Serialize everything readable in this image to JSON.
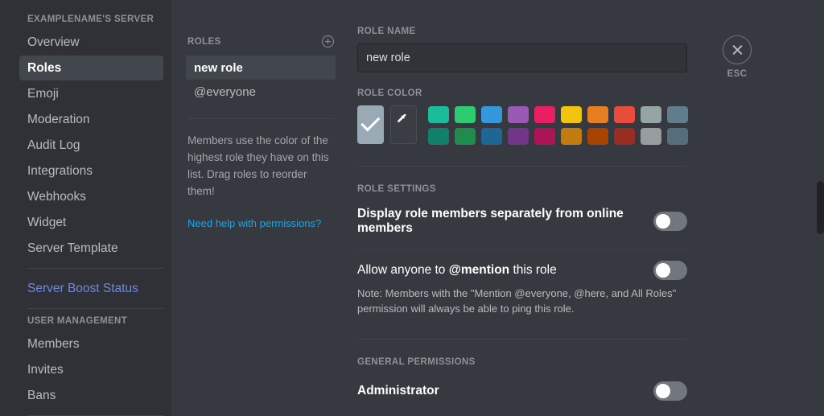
{
  "sidebar": {
    "server_header": "EXAMPLENAME'S SERVER",
    "items": [
      {
        "label": "Overview"
      },
      {
        "label": "Roles"
      },
      {
        "label": "Emoji"
      },
      {
        "label": "Moderation"
      },
      {
        "label": "Audit Log"
      },
      {
        "label": "Integrations"
      },
      {
        "label": "Webhooks"
      },
      {
        "label": "Widget"
      },
      {
        "label": "Server Template"
      }
    ],
    "boost_link": "Server Boost Status",
    "user_management_header": "USER MANAGEMENT",
    "user_items": [
      {
        "label": "Members"
      },
      {
        "label": "Invites"
      },
      {
        "label": "Bans"
      }
    ],
    "active_item": "Roles",
    "link_color": "#7289da"
  },
  "roles_panel": {
    "header": "ROLES",
    "add_icon": "plus-circle-icon",
    "roles": [
      {
        "label": "new role",
        "selected": true
      },
      {
        "label": "@everyone",
        "selected": false
      }
    ],
    "note": "Members use the color of the highest role they have on this list. Drag roles to reorder them!",
    "help_link": "Need help with permissions?",
    "help_link_color": "#00aff4"
  },
  "main": {
    "role_name_label": "ROLE NAME",
    "role_name_value": "new role",
    "role_name_placeholder": "new role",
    "role_color_label": "ROLE COLOR",
    "default_swatch": {
      "color": "#99aab5",
      "selected": true,
      "icon": "check-icon"
    },
    "custom_swatch": {
      "icon": "eyedropper-icon",
      "color": "#3a3d43"
    },
    "palette_row1": [
      "#1abc9c",
      "#2ecc71",
      "#3498db",
      "#9b59b6",
      "#e91e63",
      "#f1c40f",
      "#e67e22",
      "#e74c3c",
      "#95a5a6",
      "#607d8b"
    ],
    "palette_row2": [
      "#11806a",
      "#1f8b4c",
      "#206694",
      "#71368a",
      "#ad1457",
      "#c27c0e",
      "#a84300",
      "#992d22",
      "#979c9f",
      "#546e7a"
    ],
    "role_settings_label": "ROLE SETTINGS",
    "settings": [
      {
        "label": "Display role members separately from online members",
        "label_bold_part": "",
        "toggle": "off"
      }
    ],
    "mention_setting": {
      "label_prefix": "Allow anyone to ",
      "label_bold": "@mention",
      "label_suffix": " this role",
      "toggle": "off",
      "note": "Note: Members with the \"Mention @everyone, @here, and All Roles\" permission will always be able to ping this role."
    },
    "general_permissions_label": "GENERAL PERMISSIONS",
    "permissions": [
      {
        "label": "Administrator",
        "toggle": "off"
      }
    ]
  },
  "close": {
    "icon": "close-x-icon",
    "label": "ESC"
  }
}
